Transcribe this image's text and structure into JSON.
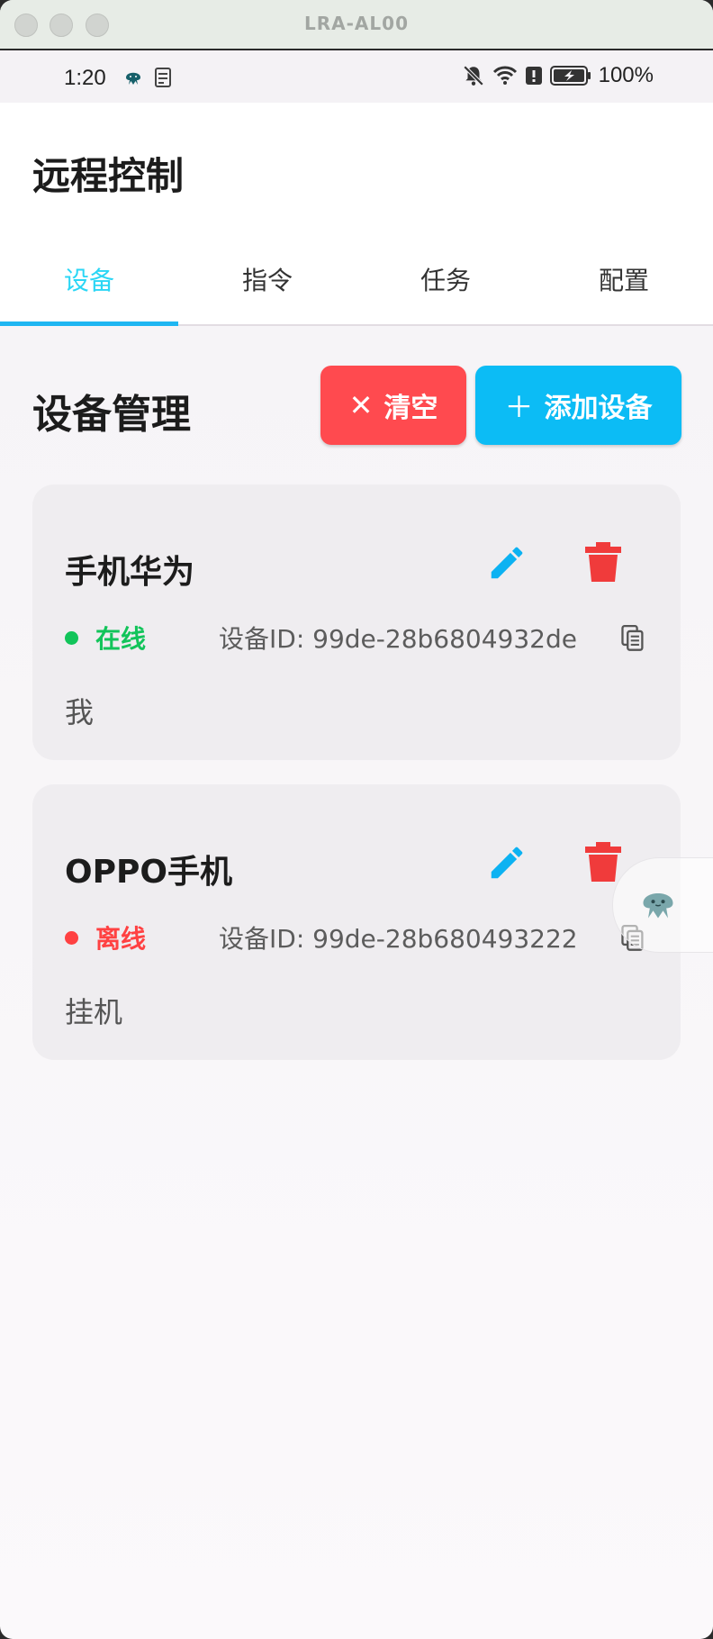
{
  "window": {
    "title": "LRA-AL00"
  },
  "status_bar": {
    "time": "1:20",
    "battery": "100%"
  },
  "app": {
    "title": "远程控制"
  },
  "tabs": [
    {
      "label": "设备",
      "active": true
    },
    {
      "label": "指令",
      "active": false
    },
    {
      "label": "任务",
      "active": false
    },
    {
      "label": "配置",
      "active": false
    }
  ],
  "section": {
    "title": "设备管理",
    "clear_label": "清空",
    "add_label": "添加设备"
  },
  "devices": [
    {
      "name": "手机华为",
      "status": "在线",
      "status_kind": "online",
      "id_text": "设备ID: 99de-28b6804932de",
      "note": "我"
    },
    {
      "name": "OPPO手机",
      "status": "离线",
      "status_kind": "offline",
      "id_text": "设备ID: 99de-28b680493222",
      "note": "挂机"
    }
  ],
  "colors": {
    "accent": "#0cbcf5",
    "danger": "#ff4a4f",
    "online": "#12c45a",
    "offline": "#ff4142",
    "tab_active": "#2bd6f5"
  },
  "icons": {
    "edit": "pencil-icon",
    "delete": "trash-icon",
    "copy": "copy-icon",
    "clear": "close-icon",
    "add": "plus-icon"
  }
}
